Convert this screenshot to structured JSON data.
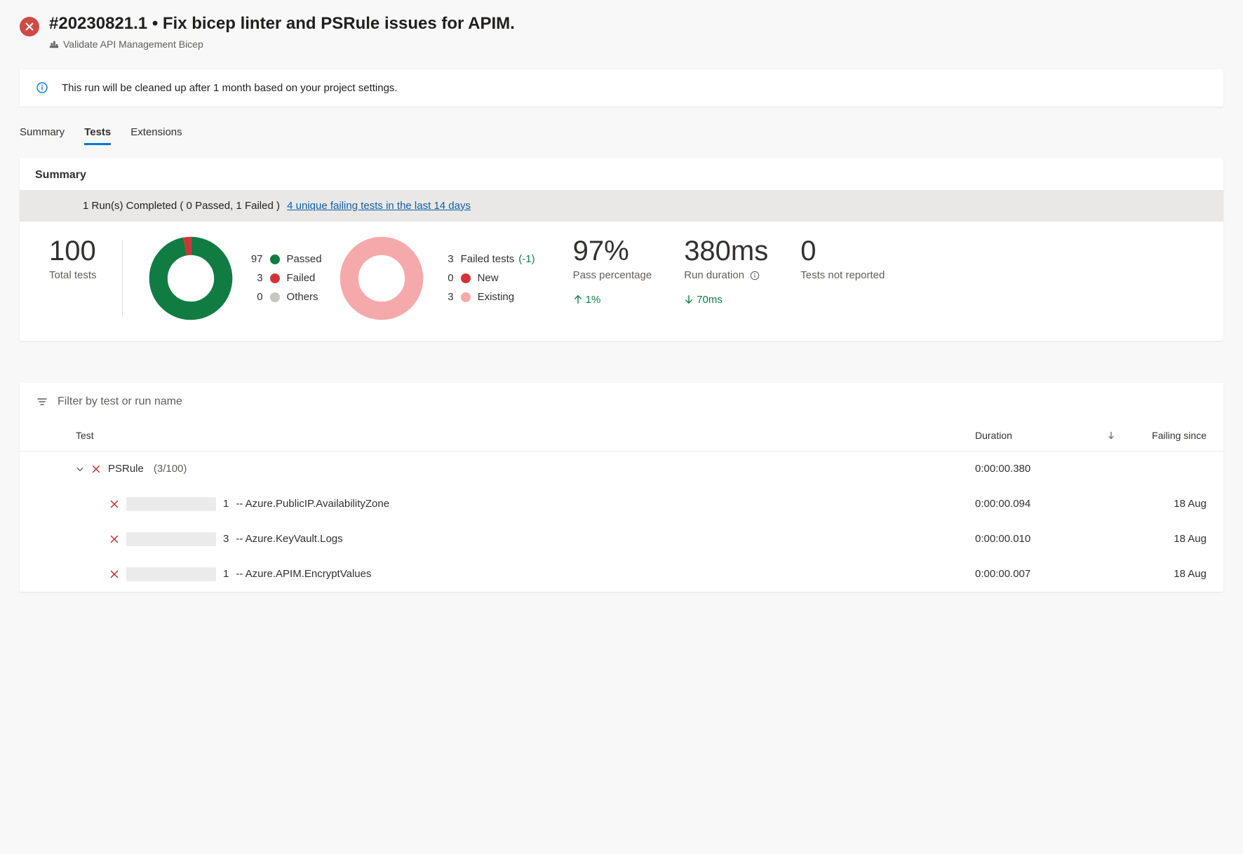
{
  "header": {
    "title": "#20230821.1 • Fix bicep linter and PSRule issues for APIM.",
    "subtitle": "Validate API Management Bicep"
  },
  "banner": {
    "text": "This run will be cleaned up after 1 month based on your project settings."
  },
  "tabs": [
    {
      "label": "Summary",
      "active": false
    },
    {
      "label": "Tests",
      "active": true
    },
    {
      "label": "Extensions",
      "active": false
    }
  ],
  "summary": {
    "title": "Summary",
    "runs_text": "1 Run(s) Completed ( 0 Passed, 1 Failed )",
    "link_text": "4 unique failing tests in the last 14 days",
    "total_tests": {
      "value": "100",
      "label": "Total tests"
    },
    "donut1_legend": [
      {
        "num": "97",
        "color": "#107c41",
        "label": "Passed"
      },
      {
        "num": "3",
        "color": "#d13438",
        "label": "Failed"
      },
      {
        "num": "0",
        "color": "#c8c6c4",
        "label": "Others"
      }
    ],
    "failed_tests_header": {
      "num": "3",
      "label": "Failed tests",
      "suffix": "(-1)"
    },
    "donut2_legend": [
      {
        "num": "0",
        "color": "#d13438",
        "label": "New"
      },
      {
        "num": "3",
        "color": "#f6a9ab",
        "label": "Existing"
      }
    ],
    "pass_pct": {
      "value": "97%",
      "label": "Pass percentage",
      "delta": "1%"
    },
    "duration": {
      "value": "380ms",
      "label": "Run duration",
      "delta": "70ms"
    },
    "not_reported": {
      "value": "0",
      "label": "Tests not reported"
    }
  },
  "chart_data": [
    {
      "type": "pie",
      "title": "Test outcomes",
      "series": [
        {
          "name": "Passed",
          "value": 97,
          "color": "#107c41"
        },
        {
          "name": "Failed",
          "value": 3,
          "color": "#d13438"
        },
        {
          "name": "Others",
          "value": 0,
          "color": "#c8c6c4"
        }
      ]
    },
    {
      "type": "pie",
      "title": "Failed tests breakdown",
      "series": [
        {
          "name": "New",
          "value": 0,
          "color": "#d13438"
        },
        {
          "name": "Existing",
          "value": 3,
          "color": "#f6a9ab"
        }
      ]
    }
  ],
  "tests_table": {
    "filter_placeholder": "Filter by test or run name",
    "columns": {
      "test": "Test",
      "duration": "Duration",
      "failing": "Failing since"
    },
    "group": {
      "name": "PSRule",
      "count": "(3/100)",
      "duration": "0:00:00.380"
    },
    "rows": [
      {
        "prefix": "1",
        "name": " -- Azure.PublicIP.AvailabilityZone",
        "duration": "0:00:00.094",
        "failing": "18 Aug"
      },
      {
        "prefix": "3",
        "name": " -- Azure.KeyVault.Logs",
        "duration": "0:00:00.010",
        "failing": "18 Aug"
      },
      {
        "prefix": "1",
        "name": " -- Azure.APIM.EncryptValues",
        "duration": "0:00:00.007",
        "failing": "18 Aug"
      }
    ]
  }
}
